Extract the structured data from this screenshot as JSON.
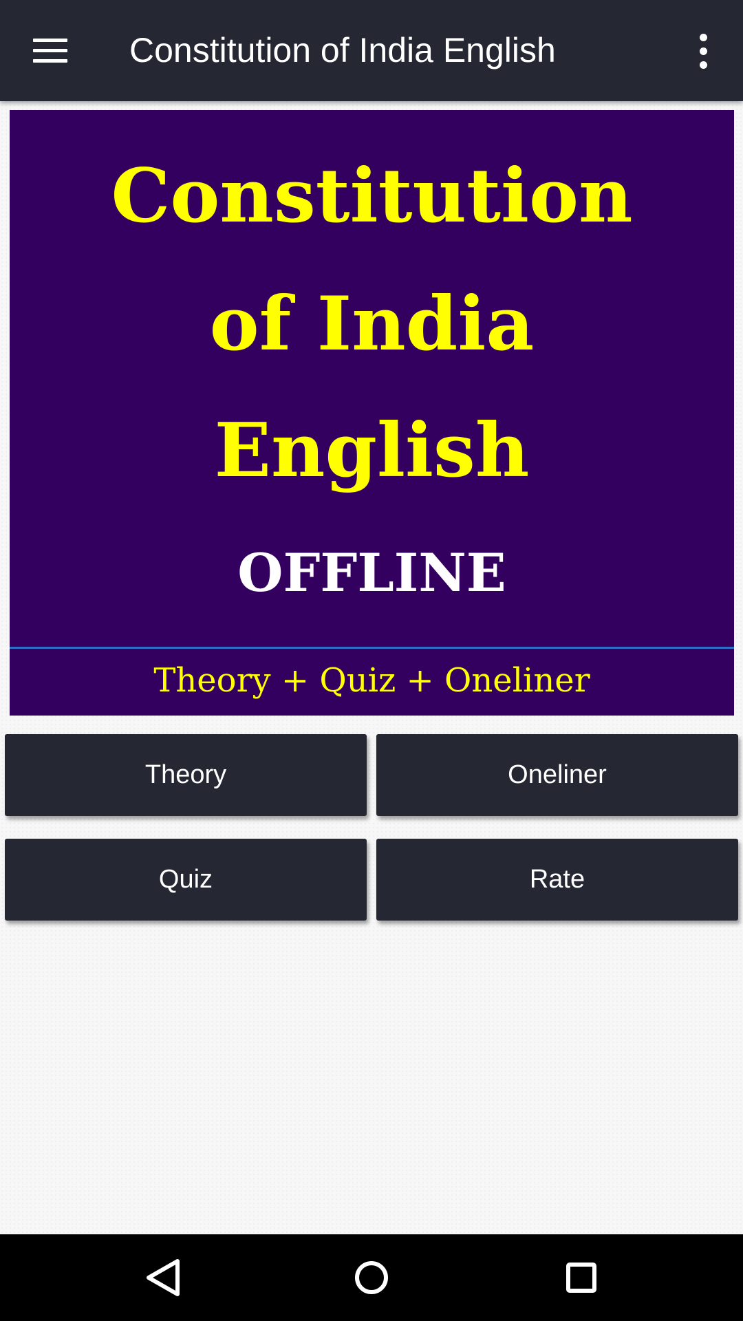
{
  "toolbar": {
    "title": "Constitution of India English",
    "menu_icon": "hamburger-menu-icon",
    "overflow_icon": "more-vert-icon"
  },
  "banner": {
    "line1": "Constitution",
    "line2": "of India",
    "line3": "English",
    "line4": "OFFLINE",
    "line5": "Theory + Quiz + Oneliner",
    "background_color": "#330060",
    "title_color": "#ffff00"
  },
  "buttons": {
    "theory": "Theory",
    "oneliner": "Oneliner",
    "quiz": "Quiz",
    "rate": "Rate"
  },
  "navbar": {
    "back_icon": "back-triangle-icon",
    "home_icon": "home-circle-icon",
    "recent_icon": "recent-apps-square-icon"
  },
  "colors": {
    "toolbar": "#252733",
    "button": "#252733",
    "button_text": "#ffffff",
    "page_background": "#f7f7f7"
  }
}
